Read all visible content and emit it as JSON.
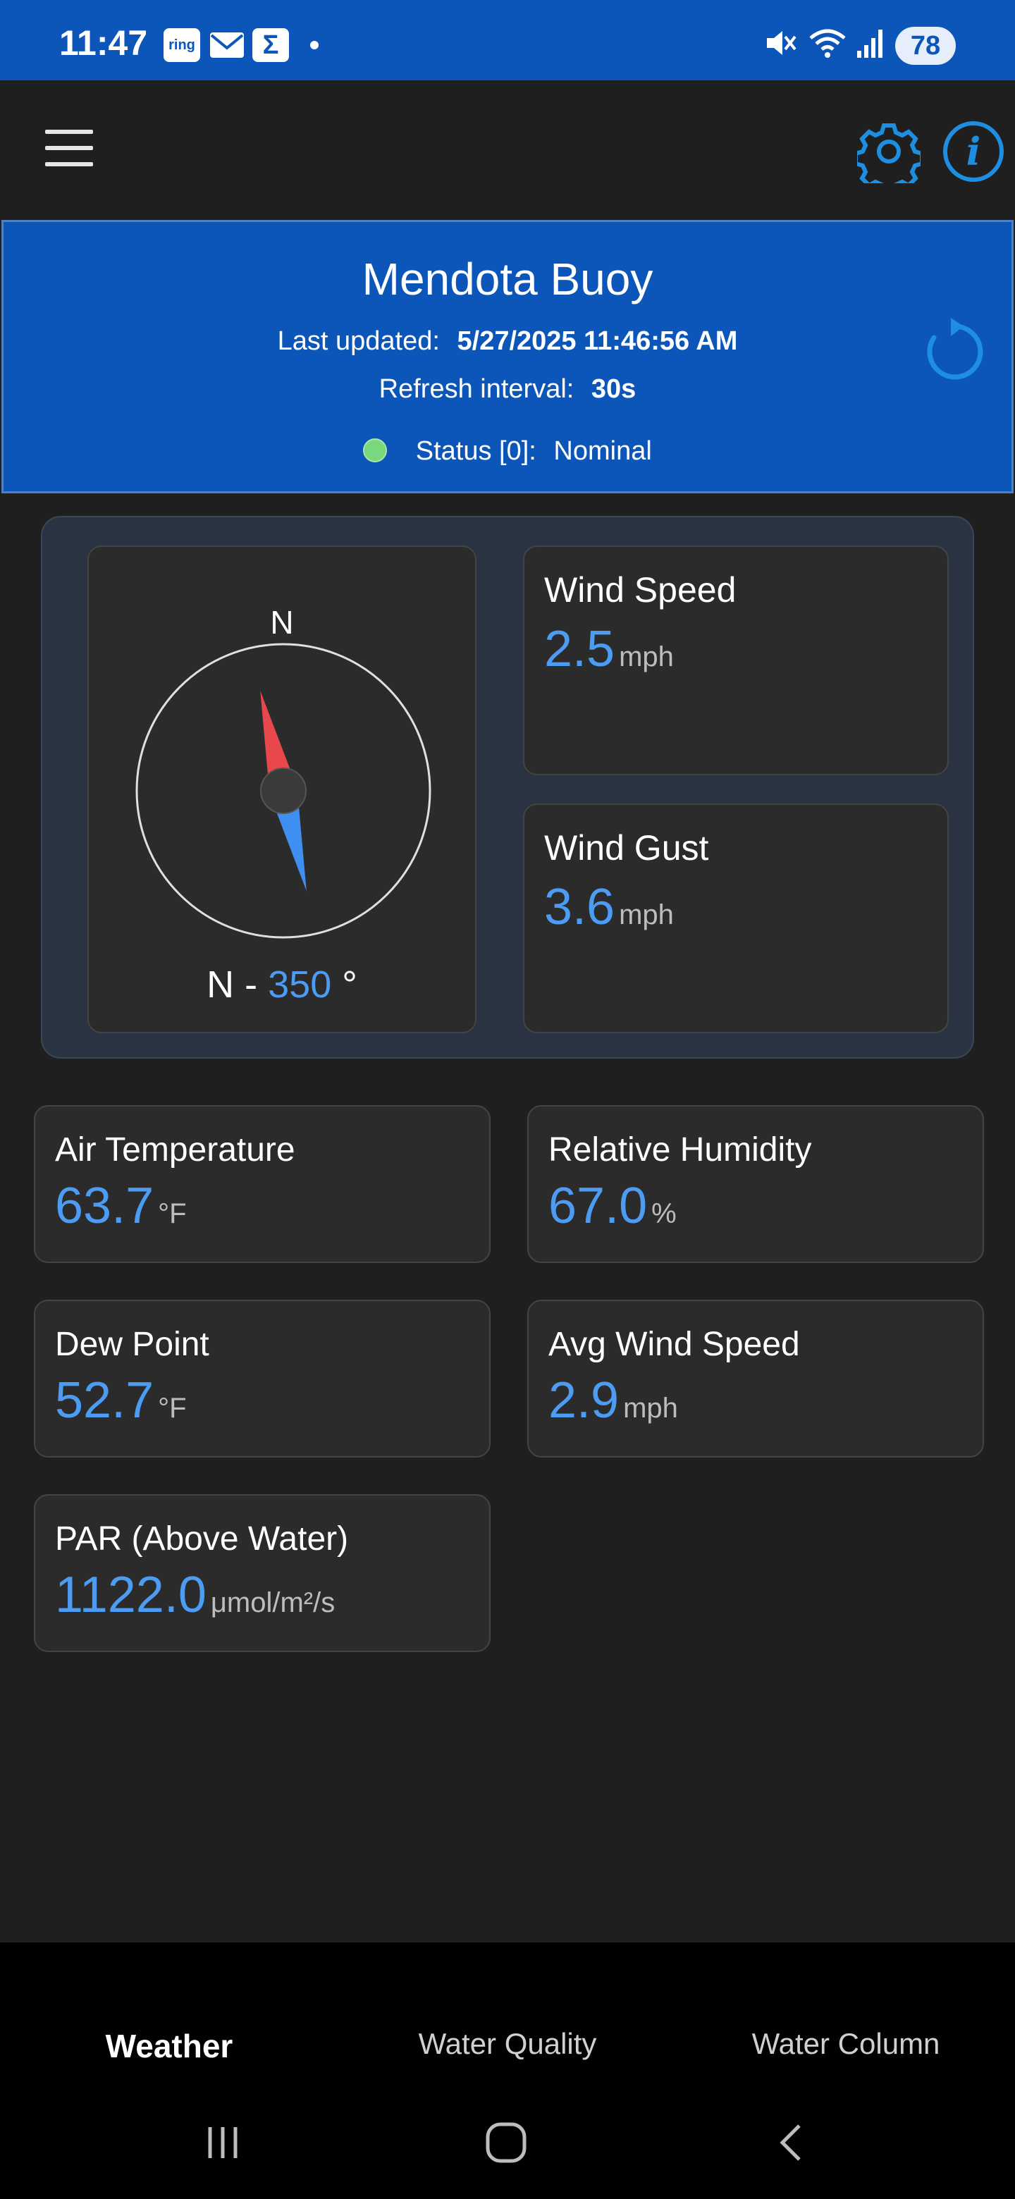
{
  "status_bar": {
    "time": "11:47",
    "notification_icons": [
      "ring-icon",
      "mail-icon",
      "sigma-icon",
      "dot"
    ],
    "ring_label": "ring",
    "sigma_label": "Σ",
    "battery": "78"
  },
  "app_bar": {
    "menu_icon": "hamburger-menu-icon",
    "settings_icon": "gear-icon",
    "info_icon": "info-icon",
    "info_glyph": "i"
  },
  "banner": {
    "title": "Mendota Buoy",
    "last_updated_label": "Last updated:",
    "last_updated_value": "5/27/2025 11:46:56 AM",
    "refresh_interval_label": "Refresh interval:",
    "refresh_interval_value": "30s",
    "status_label": "Status [0]:",
    "status_value": "Nominal",
    "status_color": "#79d87b"
  },
  "wind": {
    "compass": {
      "north_label": "N",
      "direction_label": "N -",
      "direction_degrees": "350",
      "degree_symbol": "°"
    },
    "wind_speed": {
      "label": "Wind Speed",
      "value": "2.5",
      "unit": "mph"
    },
    "wind_gust": {
      "label": "Wind Gust",
      "value": "3.6",
      "unit": "mph"
    }
  },
  "metrics": [
    {
      "label": "Air Temperature",
      "value": "63.7",
      "unit": "°F"
    },
    {
      "label": "Relative Humidity",
      "value": "67.0",
      "unit": "%"
    },
    {
      "label": "Dew Point",
      "value": "52.7",
      "unit": "°F"
    },
    {
      "label": "Avg Wind Speed",
      "value": "2.9",
      "unit": "mph"
    },
    {
      "label": "PAR (Above Water)",
      "value": "1122.0",
      "unit": "μmol/m²/s"
    }
  ],
  "tabs": [
    {
      "label": "Weather",
      "active": true
    },
    {
      "label": "Water Quality",
      "active": false
    },
    {
      "label": "Water Column",
      "active": false
    }
  ],
  "colors": {
    "accent": "#4c9cf4",
    "brand_blue": "#0b56b8",
    "background": "#1f1f1f",
    "card": "#2b2b2b",
    "compass_north": "#e8474c",
    "compass_south": "#3f8ff0"
  }
}
